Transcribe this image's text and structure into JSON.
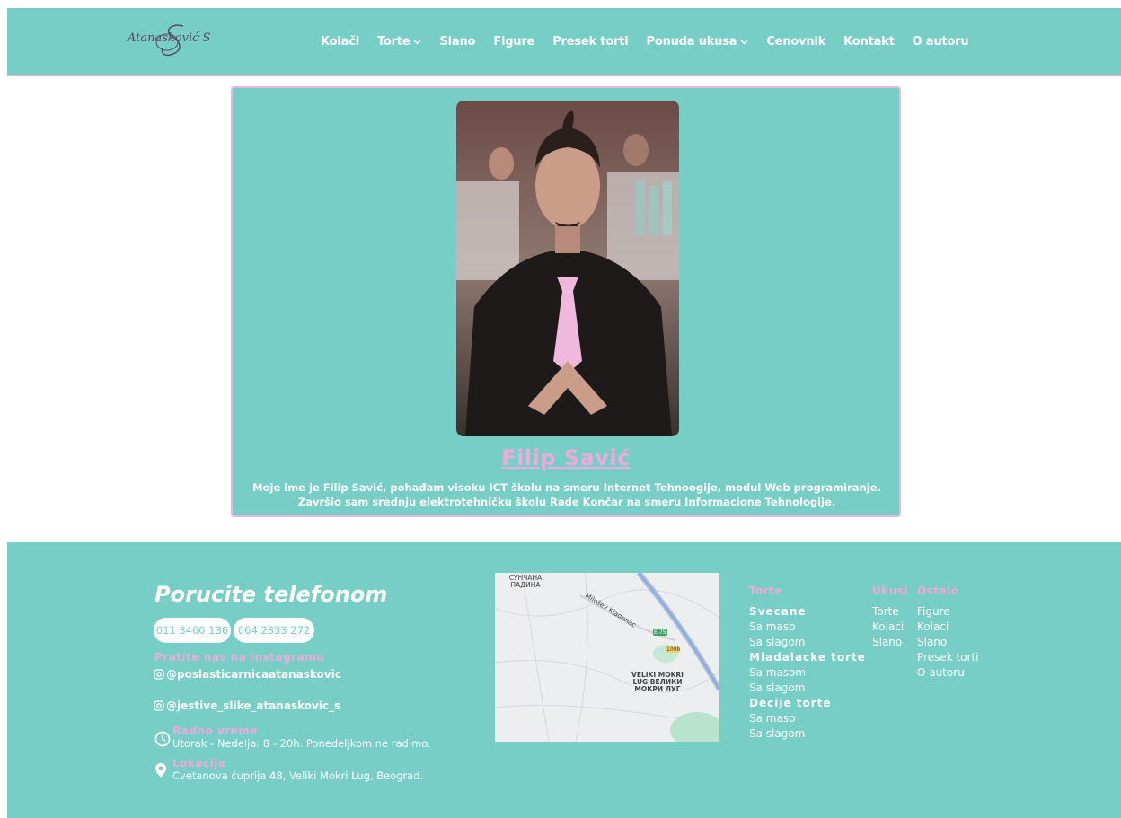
{
  "header": {
    "logo": {
      "text": "Atanasković S",
      "monogram": "S"
    },
    "nav": [
      {
        "label": "Kolači",
        "dropdown": false
      },
      {
        "label": "Torte",
        "dropdown": true
      },
      {
        "label": "Slano",
        "dropdown": false
      },
      {
        "label": "Figure",
        "dropdown": false
      },
      {
        "label": "Presek torti",
        "dropdown": false
      },
      {
        "label": "Ponuda ukusa",
        "dropdown": true
      },
      {
        "label": "Cenovnik",
        "dropdown": false
      },
      {
        "label": "Kontakt",
        "dropdown": false
      },
      {
        "label": "O autoru",
        "dropdown": false
      }
    ]
  },
  "author": {
    "name": "Filip Savić",
    "bio": "Moje ime je Filip Savić, pohađam visoku ICT školu na smeru Internet Tehnoogije, modul Web programiranje. Završio sam srednju elektrotehničku školu Rade Končar na smeru Informacione Tehnologije."
  },
  "footer": {
    "order_title": "Porucite telefonom",
    "phones": [
      "011 3460 136",
      "064 2333 272"
    ],
    "instagram_heading": "Pratite nas na instagramu",
    "instagram_links": [
      "@poslasticarnicaatanaskovic",
      "@jestive_slike_atanaskovic_s"
    ],
    "hours": {
      "heading": "Radno vreme",
      "text": "Utorak - Nedelja: 8 - 20h. Ponedeljkom ne radimo."
    },
    "location": {
      "heading": "Lokacija",
      "text": "Cvetanova ćuprija 48, Veliki Mokri Lug, Beograd."
    },
    "map": {
      "label_top": "СУНЧАНА ПАДИНА",
      "label_road": "Milošev Kladenac",
      "label_center": "VELIKI MOKRI LUG ВЕЛИКИ МОКРИ ЛУГ",
      "road_badge_1": "E-75",
      "road_badge_2": "100b"
    },
    "torte": {
      "heading": "Torte",
      "groups": [
        {
          "title": "Svecane",
          "items": [
            "Sa maso",
            "Sa slagom"
          ]
        },
        {
          "title": "Mladalacke torte",
          "items": [
            "Sa masom",
            "Sa slagom"
          ]
        },
        {
          "title": "Decije torte",
          "items": [
            "Sa maso",
            "Sa slagom"
          ]
        }
      ]
    },
    "ukusi": {
      "heading": "Ukusi",
      "items": [
        "Torte",
        "Kolaci",
        "Slano"
      ]
    },
    "ostalo": {
      "heading": "Ostalo",
      "items": [
        "Figure",
        "Kolaci",
        "Slano",
        "Presek torti",
        "O autoru"
      ]
    }
  },
  "colors": {
    "teal": "#77cec6",
    "pink": "#eea9dd",
    "white": "#ffffff"
  }
}
